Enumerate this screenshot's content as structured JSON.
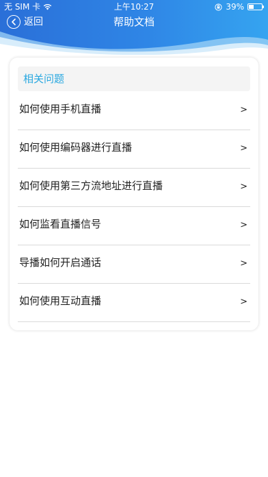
{
  "status_bar": {
    "carrier": "无 SIM 卡",
    "time": "上午10:27",
    "battery": "39%",
    "battery_level": 0.39,
    "wifi_icon": "wifi-icon",
    "lock_icon": "orientation-lock-icon"
  },
  "nav": {
    "back_label": "返回",
    "title": "帮助文档"
  },
  "card": {
    "title": "相关问题"
  },
  "list": {
    "items": [
      {
        "label": "如何使用手机直播",
        "arrow": ">"
      },
      {
        "label": "如何使用编码器进行直播",
        "arrow": ">"
      },
      {
        "label": "如何使用第三方流地址进行直播",
        "arrow": ">"
      },
      {
        "label": "如何监看直播信号",
        "arrow": ">"
      },
      {
        "label": "导播如何开启通话",
        "arrow": ">"
      },
      {
        "label": "如何使用互动直播",
        "arrow": ">"
      }
    ]
  },
  "colors": {
    "header_start": "#2a6fd8",
    "header_end": "#35a4f0",
    "card_title": "#29a8e0"
  }
}
